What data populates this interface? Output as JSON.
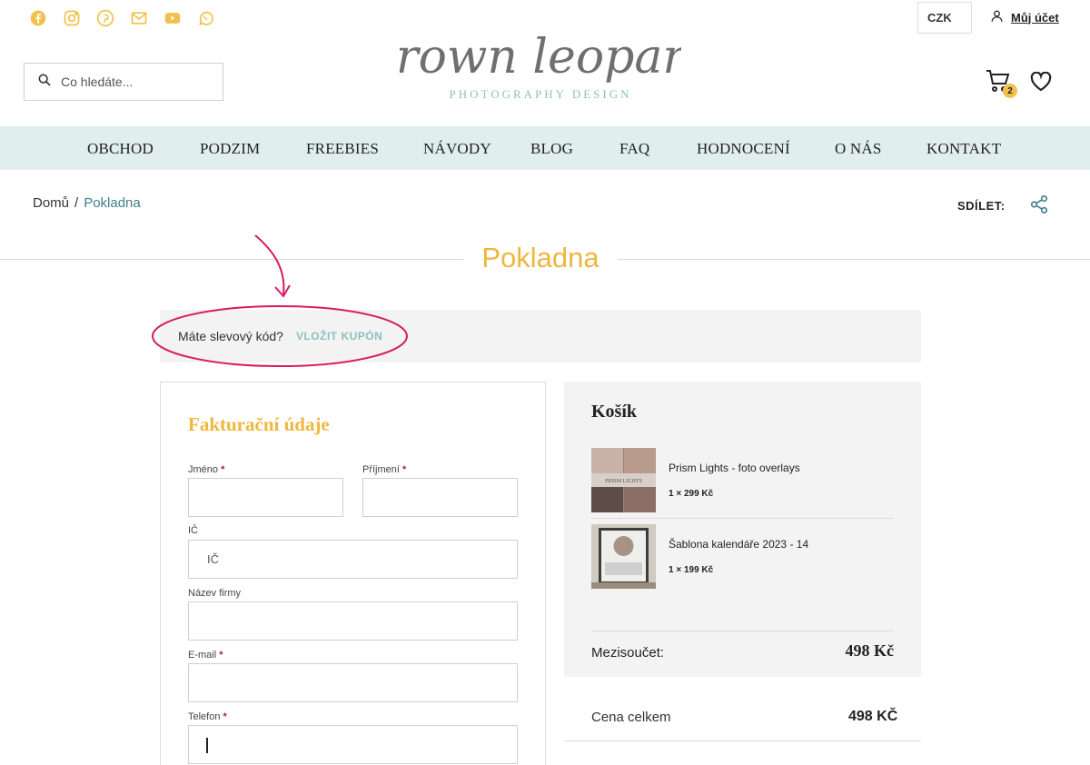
{
  "header": {
    "social_icons": [
      "facebook-icon",
      "instagram-icon",
      "pinterest-icon",
      "email-icon",
      "youtube-icon",
      "whatsapp-icon"
    ],
    "search_placeholder": "Co hledáte...",
    "logo_text": "brown leopard",
    "logo_subtext": "PHOTOGRAPHY DESIGN",
    "currency": "CZK",
    "account_label": "Můj účet",
    "cart_count": "2",
    "accent_color": "#f0b63d",
    "nav_bg": "#e1eeee"
  },
  "nav": {
    "items": [
      "OBCHOD",
      "PODZIM",
      "FREEBIES",
      "NÁVODY",
      "BLOG",
      "FAQ",
      "HODNOCENÍ",
      "O NÁS",
      "KONTAKT"
    ]
  },
  "breadcrumb": {
    "home": "Domů",
    "separator": "/",
    "current": "Pokladna"
  },
  "share_label": "SDÍLET:",
  "page_title": "Pokladna",
  "coupon": {
    "question": "Máte slevový kód?",
    "link": "VLOŽIT KUPÓN"
  },
  "billing": {
    "title": "Fakturační údaje",
    "fields": {
      "first_name": "Jméno",
      "last_name": "Příjmení",
      "ic": "IČ",
      "ic_placeholder": "IČ",
      "company": "Název firmy",
      "email": "E-mail",
      "phone": "Telefon"
    },
    "required_mark": "*"
  },
  "cart": {
    "title": "Košík",
    "items": [
      {
        "name": "Prism Lights - foto overlays",
        "qty": "1 × 299 Kč",
        "thumb_caption": "PRISM LIGHTS"
      },
      {
        "name": "Šablona kalendáře 2023 - 14",
        "qty": "1 × 199 Kč"
      }
    ],
    "subtotal_label": "Mezisoučet:",
    "subtotal_value": "498 Kč",
    "total_label": "Cena celkem",
    "total_value": "498 KČ"
  }
}
